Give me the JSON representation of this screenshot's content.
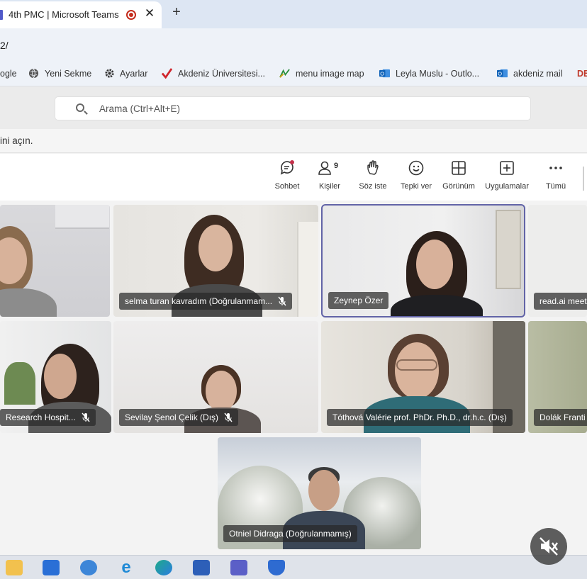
{
  "browser": {
    "tab_title": "4th PMC | Microsoft Teams",
    "tab_close": "✕",
    "new_tab": "+",
    "url": "2/"
  },
  "bookmarks": [
    {
      "label": "ogle",
      "icon": "google-icon"
    },
    {
      "label": "Yeni Sekme",
      "icon": "globe-icon"
    },
    {
      "label": "Ayarlar",
      "icon": "gear-icon"
    },
    {
      "label": "Akdeniz Üniversitesi...",
      "icon": "checkmark-icon"
    },
    {
      "label": "menu image map",
      "icon": "map-icon"
    },
    {
      "label": "Leyla Muslu - Outlo...",
      "icon": "outlook-icon"
    },
    {
      "label": "akdeniz mail",
      "icon": "outlook-icon"
    },
    {
      "label": "DE",
      "icon": ""
    }
  ],
  "teams": {
    "search_placeholder": "Arama (Ctrl+Alt+E)",
    "notice_text": "ini açın."
  },
  "toolbar": [
    {
      "label": "Sohbet",
      "icon": "chat-icon"
    },
    {
      "label": "Kişiler",
      "icon": "people-icon",
      "badge": "9"
    },
    {
      "label": "Söz iste",
      "icon": "raise-hand-icon"
    },
    {
      "label": "Tepki ver",
      "icon": "smiley-icon"
    },
    {
      "label": "Görünüm",
      "icon": "grid-view-icon"
    },
    {
      "label": "Uygulamalar",
      "icon": "add-app-icon"
    },
    {
      "label": "Tümü",
      "icon": "more-icon"
    }
  ],
  "participants": [
    {
      "name": "",
      "muted": false
    },
    {
      "name": "selma turan kavradım (Doğrulanmam...",
      "muted": true
    },
    {
      "name": "Zeynep Özer",
      "muted": false,
      "speaking": true
    },
    {
      "name": "read.ai meet",
      "muted": false
    },
    {
      "name": "Research Hospit...",
      "muted": true
    },
    {
      "name": "Sevilay Şenol Çelik (Dış)",
      "muted": true
    },
    {
      "name": "Tóthová Valérie prof. PhDr. Ph.D., dr.h.c. (Dış)",
      "muted": false
    },
    {
      "name": "Dolák Franti",
      "muted": false
    },
    {
      "name": "Otniel Didraga (Doğrulanmamış)",
      "muted": false
    }
  ],
  "taskbar": [
    {
      "icon": "file-explorer-icon",
      "color": "#f2c14e"
    },
    {
      "icon": "mail-icon",
      "color": "#2a6fd6"
    },
    {
      "icon": "control-panel-icon",
      "color": "#3d86d8"
    },
    {
      "icon": "internet-explorer-icon",
      "color": "#1f8ad6"
    },
    {
      "icon": "edge-icon",
      "color": "#1da98a"
    },
    {
      "icon": "store-icon",
      "color": "#2d5fb8"
    },
    {
      "icon": "teams-icon",
      "color": "#5b5fc7"
    },
    {
      "icon": "defender-icon",
      "color": "#2e6bd1"
    }
  ],
  "colors": {
    "teams_purple": "#6264a7",
    "record_red": "#c42b1c"
  }
}
